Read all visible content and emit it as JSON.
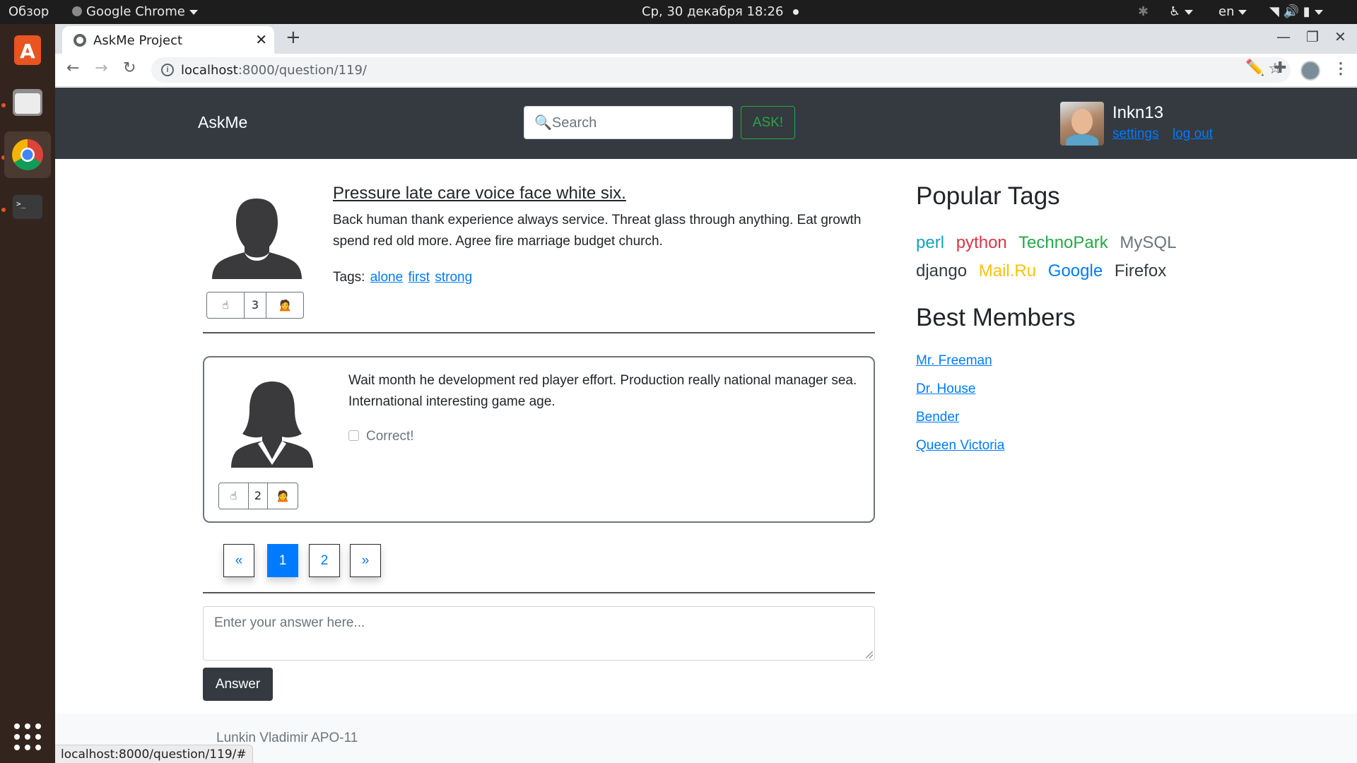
{
  "os": {
    "activities": "Обзор",
    "app_menu": "Google Chrome",
    "clock": "Ср, 30 декабря  18:26",
    "lang": "en",
    "dock_icons": [
      "ubuntu-software-icon",
      "files-icon",
      "chrome-icon",
      "terminal-icon",
      "show-apps-icon"
    ]
  },
  "browser": {
    "tab_title": "AskMe Project",
    "url_host": "localhost",
    "url_path": ":8000/question/119/",
    "status_url": "localhost:8000/question/119/#"
  },
  "navbar": {
    "brand": "AskMe",
    "search_placeholder": "🔍Search",
    "ask_label": "ASK!",
    "username": "Inkn13",
    "settings_label": "settings",
    "logout_label": "log out"
  },
  "question": {
    "title": "Pressure late care voice face white six.",
    "text": "Back human thank experience always service. Threat glass through anything. Eat growth spend red old more. Agree fire marriage budget church.",
    "tags_label": "Tags:",
    "tags": [
      "alone",
      "first",
      "strong"
    ],
    "vote_up": "☝",
    "rating": "3",
    "vote_down": "🙍"
  },
  "answers": [
    {
      "text": "Wait month he development red player effort. Production really national manager sea. International interesting game age.",
      "correct_label": "Correct!",
      "correct": false,
      "vote_up": "☝",
      "rating": "2",
      "vote_down": "🙍"
    }
  ],
  "pagination": {
    "prev": "«",
    "pages": [
      "1",
      "2"
    ],
    "current": "1",
    "next": "»"
  },
  "answer_form": {
    "placeholder": "Enter your answer here...",
    "submit_label": "Answer"
  },
  "sidebar": {
    "popular_tags_title": "Popular Tags",
    "tags": [
      {
        "name": "perl",
        "color": "#17a2b8"
      },
      {
        "name": "python",
        "color": "#dc3545"
      },
      {
        "name": "TechnoPark",
        "color": "#28a745"
      },
      {
        "name": "MySQL",
        "color": "#6c757d"
      },
      {
        "name": "django",
        "color": "#343a40"
      },
      {
        "name": "Mail.Ru",
        "color": "#ffc107"
      },
      {
        "name": "Google",
        "color": "#007bff"
      },
      {
        "name": "Firefox",
        "color": "#343a40"
      }
    ],
    "best_members_title": "Best Members",
    "members": [
      "Mr. Freeman",
      "Dr. House",
      "Bender",
      "Queen Victoria"
    ]
  },
  "footer": {
    "text": "Lunkin Vladimir APO-11"
  }
}
